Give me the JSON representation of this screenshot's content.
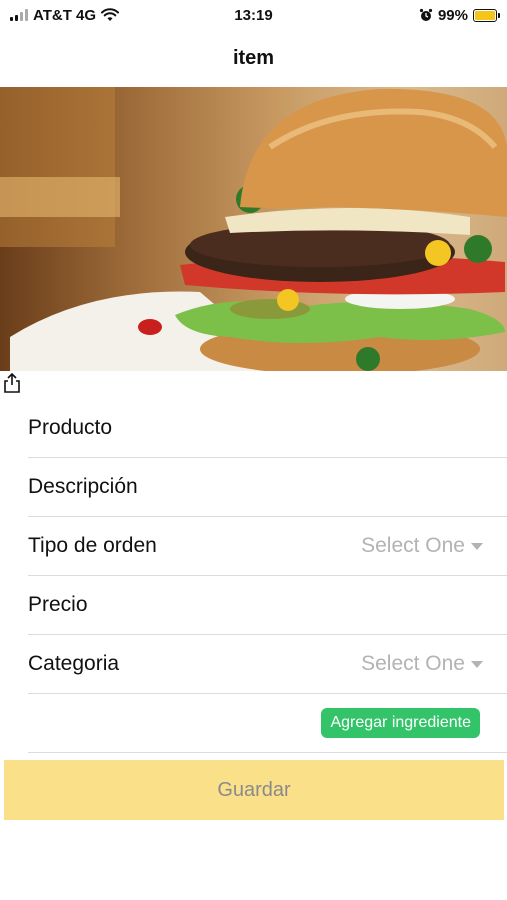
{
  "status_bar": {
    "carrier": "AT&T 4G",
    "time": "13:19",
    "battery": "99%"
  },
  "nav": {
    "title": "item"
  },
  "form": {
    "producto_label": "Producto",
    "descripcion_label": "Descripción",
    "tipo_orden_label": "Tipo de orden",
    "tipo_orden_value": "Select One",
    "precio_label": "Precio",
    "categoria_label": "Categoria",
    "categoria_value": "Select One",
    "add_ingredient_label": "Agregar ingrediente"
  },
  "save_label": "Guardar",
  "colors": {
    "accent_green": "#33c46a",
    "save_button": "#fbe08a",
    "battery": "#f5c518"
  }
}
